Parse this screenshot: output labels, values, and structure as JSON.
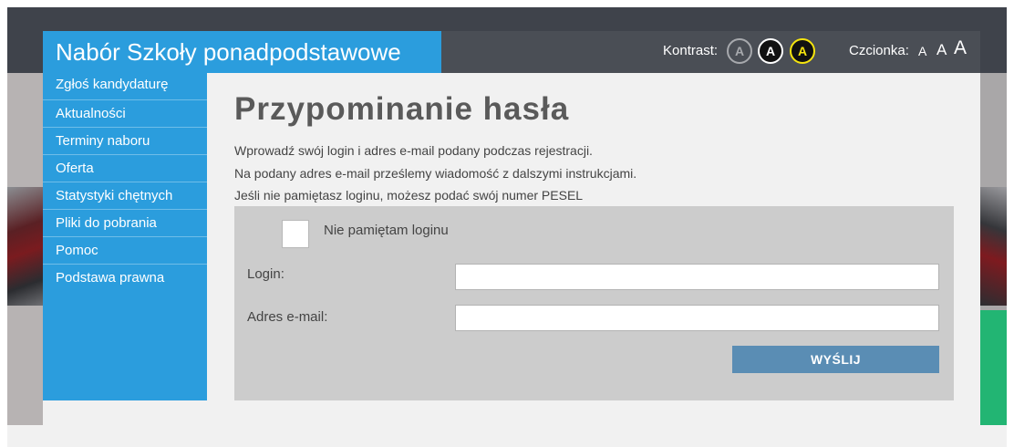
{
  "header": {
    "brand_title": "Nabór Szkoły ponadpodstawowe",
    "contrast_label": "Kontrast:",
    "contrast_options": [
      {
        "label": "A",
        "color": "#a7a9ad"
      },
      {
        "label": "A",
        "color": "#ffffff"
      },
      {
        "label": "A",
        "color": "#f6e50e"
      }
    ],
    "font_label": "Czcionka:",
    "font_sizes": [
      "A",
      "A",
      "A"
    ]
  },
  "sidebar": {
    "items": [
      {
        "label": "Zgłoś kandydaturę"
      },
      {
        "label": "Aktualności"
      },
      {
        "label": "Terminy naboru"
      },
      {
        "label": "Oferta"
      },
      {
        "label": "Statystyki chętnych"
      },
      {
        "label": "Pliki do pobrania"
      },
      {
        "label": "Pomoc"
      },
      {
        "label": "Podstawa prawna"
      }
    ]
  },
  "main": {
    "title": "Przypominanie hasła",
    "description": [
      "Wprowadź swój login i adres e-mail podany podczas rejestracji.",
      "Na podany adres e-mail prześlemy wiadomość z dalszymi instrukcjami.",
      "Jeśli nie pamiętasz loginu, możesz podać swój numer PESEL"
    ],
    "form": {
      "checkbox_label": "Nie pamiętam loginu",
      "login_label": "Login:",
      "login_value": "",
      "email_label": "Adres e-mail:",
      "email_value": "",
      "submit_label": "WYŚLIJ"
    }
  },
  "colors": {
    "brand_blue": "#2b9ddd",
    "header_dark": "#3f434b",
    "submit_blue": "#5a8db4",
    "form_gray": "#cccccc"
  }
}
